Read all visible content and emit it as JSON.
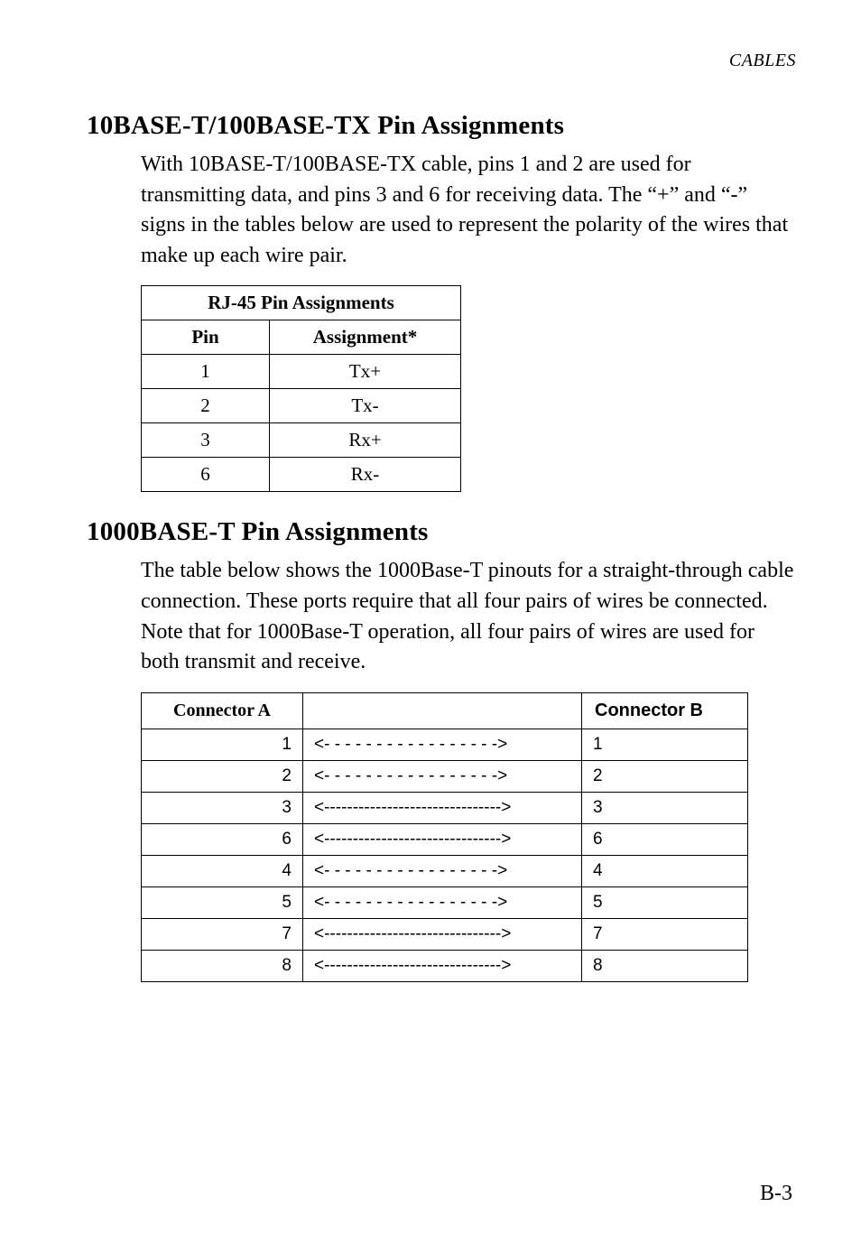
{
  "running_head": "CABLES",
  "section1": {
    "title": "10BASE-T/100BASE-TX Pin Assignments",
    "paragraph": "With 10BASE-T/100BASE-TX cable, pins 1 and 2 are used for transmitting data, and pins 3 and 6 for receiving data. The “+” and “-” signs in the tables below are used to represent the polarity of the wires that make up each wire pair."
  },
  "rj45_table": {
    "caption": "RJ-45 Pin Assignments",
    "head_pin": "Pin",
    "head_assign": "Assignment*",
    "rows": [
      {
        "pin": "1",
        "assign": "Tx+"
      },
      {
        "pin": "2",
        "assign": "Tx-"
      },
      {
        "pin": "3",
        "assign": "Rx+"
      },
      {
        "pin": "6",
        "assign": "Rx-"
      }
    ]
  },
  "section2": {
    "title": "1000BASE-T Pin Assignments",
    "paragraph": "The table below shows the 1000Base-T pinouts for a straight-through cable connection. These ports require that all four pairs of wires be connected. Note that for 1000Base-T operation, all four pairs of wires are used for both transmit and receive."
  },
  "conn_table": {
    "head_a": "Connector A",
    "head_b": "Connector B",
    "rows": [
      {
        "a": "1",
        "arrow": "<- - - - - - - - - - - - - - - - ->",
        "b": "1"
      },
      {
        "a": "2",
        "arrow": "<- - - - - - - - - - - - - - - - ->",
        "b": "2"
      },
      {
        "a": "3",
        "arrow": "<------------------------------->",
        "b": "3"
      },
      {
        "a": "6",
        "arrow": "<------------------------------->",
        "b": "6"
      },
      {
        "a": "4",
        "arrow": "<- - - - - - - - - - - - - - - - ->",
        "b": "4"
      },
      {
        "a": "5",
        "arrow": "<- - - - - - - - - - - - - - - - ->",
        "b": "5"
      },
      {
        "a": "7",
        "arrow": "<------------------------------->",
        "b": "7"
      },
      {
        "a": "8",
        "arrow": "<------------------------------->",
        "b": "8"
      }
    ]
  },
  "page_number": "B-3"
}
